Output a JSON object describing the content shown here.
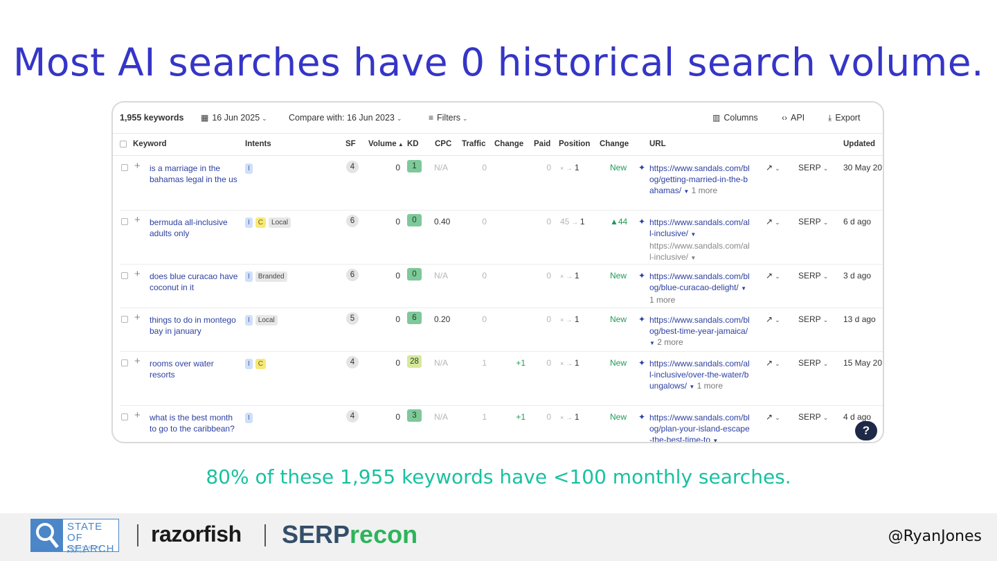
{
  "slide": {
    "title": "Most AI searches have 0 historical search volume.",
    "caption": "80% of these 1,955 keywords have <100 monthly searches.",
    "handle": "@RyanJones"
  },
  "toolbar": {
    "keyword_count": "1,955 keywords",
    "date": "16 Jun 2025",
    "compare": "Compare with: 16 Jun 2023",
    "filters": "Filters",
    "columns": "Columns",
    "api": "API",
    "export": "Export"
  },
  "columns": {
    "keyword": "Keyword",
    "intents": "Intents",
    "sf": "SF",
    "volume": "Volume",
    "kd": "KD",
    "cpc": "CPC",
    "traffic": "Traffic",
    "change": "Change",
    "paid": "Paid",
    "position": "Position",
    "change2": "Change",
    "url": "URL",
    "updated": "Updated"
  },
  "rows": [
    {
      "keyword": "is a marriage in the bahamas legal in the us",
      "intents": [
        "I"
      ],
      "sf": "4",
      "volume": "0",
      "kd": "1",
      "kd_color": "#7ec89a",
      "cpc": "N/A",
      "traffic": "0",
      "change": "",
      "paid": "0",
      "pos_from": "×",
      "pos_to": "1",
      "pos_change": "New",
      "url": "https://www.sandals.com/blog/getting-married-in-the-bahamas/",
      "url_extra": "",
      "url_more": "1 more",
      "serp": "SERP",
      "updated": "30 May 20"
    },
    {
      "keyword": "bermuda all-inclusive adults only",
      "intents": [
        "I",
        "C",
        "Local"
      ],
      "sf": "6",
      "volume": "0",
      "kd": "0",
      "kd_color": "#7ec89a",
      "cpc": "0.40",
      "traffic": "0",
      "change": "",
      "paid": "0",
      "pos_from": "45",
      "pos_to": "1",
      "pos_change": "▲44",
      "url": "https://www.sandals.com/all-inclusive/",
      "url_extra": "https://www.sandals.com/all-inclusive/",
      "url_more": "",
      "serp": "SERP",
      "updated": "6 d ago"
    },
    {
      "keyword": "does blue curacao have coconut in it",
      "intents": [
        "I",
        "Branded"
      ],
      "sf": "6",
      "volume": "0",
      "kd": "0",
      "kd_color": "#7ec89a",
      "cpc": "N/A",
      "traffic": "0",
      "change": "",
      "paid": "0",
      "pos_from": "×",
      "pos_to": "1",
      "pos_change": "New",
      "url": "https://www.sandals.com/blog/blue-curacao-delight/",
      "url_extra": "",
      "url_more": "1 more",
      "serp": "SERP",
      "updated": "3 d ago"
    },
    {
      "keyword": "things to do in montego bay in january",
      "intents": [
        "I",
        "Local"
      ],
      "sf": "5",
      "volume": "0",
      "kd": "6",
      "kd_color": "#7ec89a",
      "cpc": "0.20",
      "traffic": "0",
      "change": "",
      "paid": "0",
      "pos_from": "×",
      "pos_to": "1",
      "pos_change": "New",
      "url": "https://www.sandals.com/blog/best-time-year-jamaica/",
      "url_extra": "",
      "url_more": "2 more",
      "serp": "SERP",
      "updated": "13 d ago"
    },
    {
      "keyword": "rooms over water resorts",
      "intents": [
        "I",
        "C"
      ],
      "sf": "4",
      "volume": "0",
      "kd": "28",
      "kd_color": "#d7e89a",
      "cpc": "N/A",
      "traffic": "1",
      "change": "+1",
      "paid": "0",
      "pos_from": "×",
      "pos_to": "1",
      "pos_change": "New",
      "url": "https://www.sandals.com/all-inclusive/over-the-water/bungalows/",
      "url_extra": "",
      "url_more": "1 more",
      "serp": "SERP",
      "updated": "15 May 20"
    },
    {
      "keyword": "what is the best month to go to the caribbean?",
      "intents": [
        "I"
      ],
      "sf": "4",
      "volume": "0",
      "kd": "3",
      "kd_color": "#7ec89a",
      "cpc": "N/A",
      "traffic": "1",
      "change": "+1",
      "paid": "0",
      "pos_from": "×",
      "pos_to": "1",
      "pos_change": "New",
      "url": "https://www.sandals.com/blog/plan-your-island-escape-the-best-time-to",
      "url_extra": "",
      "url_more": "",
      "serp": "SERP",
      "updated": "4 d ago"
    }
  ],
  "footer": {
    "logo_state_of_search": "STATE OF SEARCH",
    "logo_sub": "PRESENTED BY DEMTEM",
    "logo_razorfish": "razorfish",
    "logo_serp": "SERP",
    "logo_recon": "recon"
  },
  "colors": {
    "title": "#3535c7",
    "caption": "#19c1a0",
    "link": "#2b3fa0",
    "positive": "#1f9a55"
  }
}
